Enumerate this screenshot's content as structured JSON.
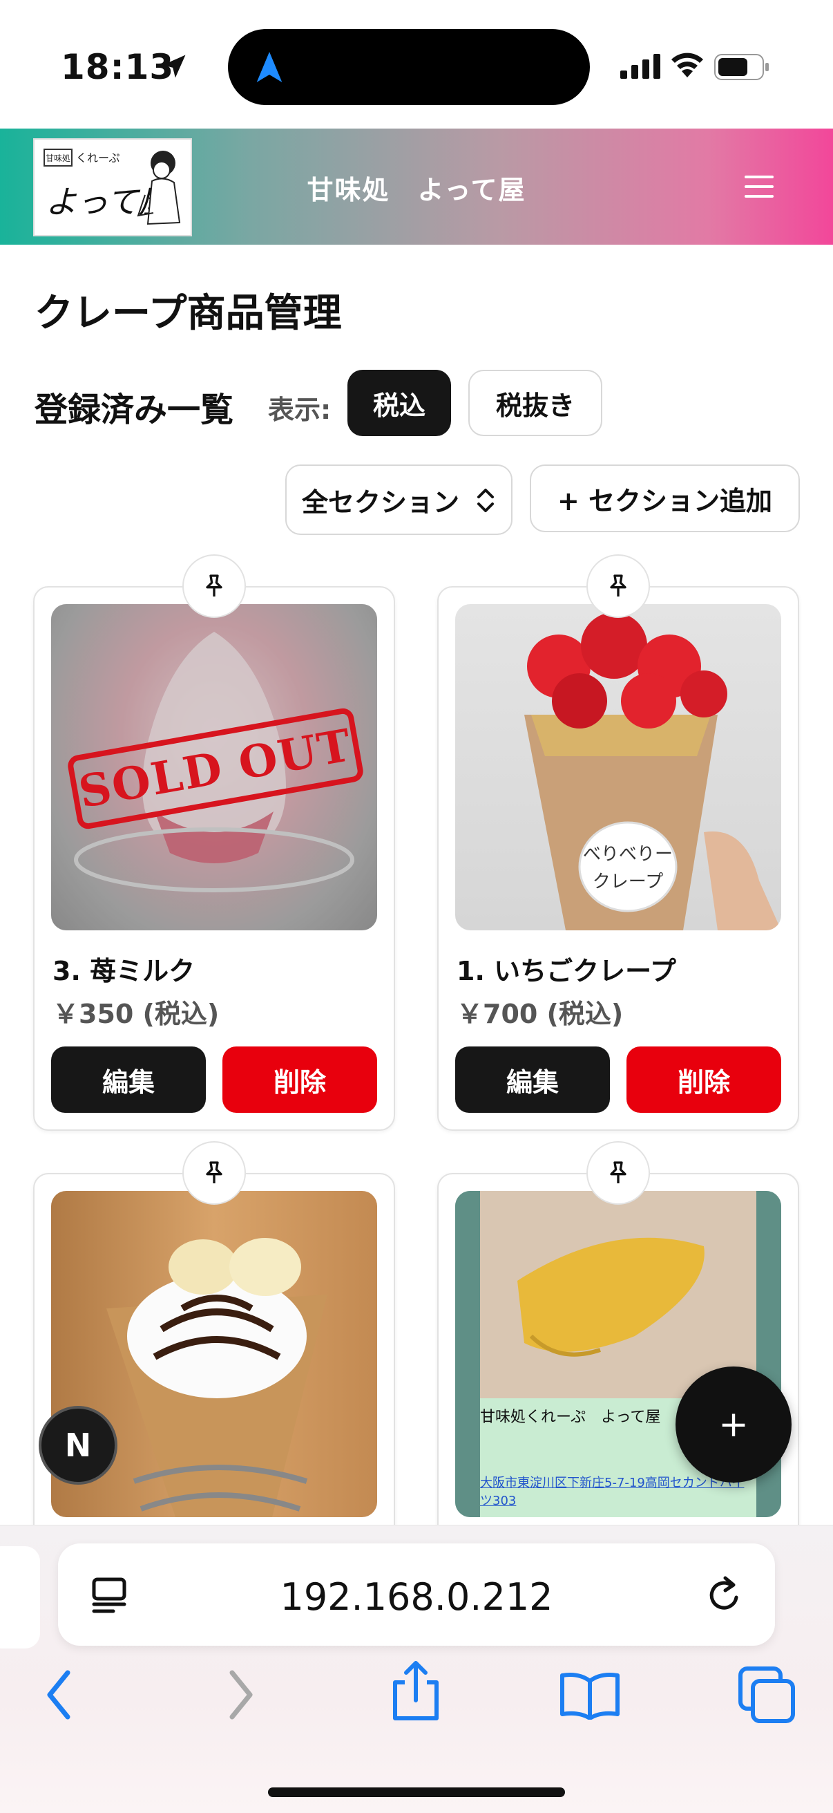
{
  "status_bar": {
    "time": "18:13"
  },
  "header": {
    "title": "甘味処　よって屋",
    "logo_alt": "甘味処 くれーぷ よって屋"
  },
  "page": {
    "title": "クレープ商品管理"
  },
  "list": {
    "title": "登録済み一覧",
    "tax_label": "表示:",
    "tax_in": "税込",
    "tax_ex": "税抜き",
    "section_select": "全セクション",
    "add_section": "+ セクション追加"
  },
  "products": [
    {
      "name": "3. 苺ミルク",
      "price": "￥350 (税込)",
      "edit": "編集",
      "delete": "削除",
      "sold_out_text": "SOLD OUT"
    },
    {
      "name": "1. いちごクレープ",
      "price": "￥700 (税込)",
      "edit": "編集",
      "delete": "削除"
    },
    {
      "name": "",
      "price": ""
    },
    {
      "name": "",
      "price": "",
      "shop_text": "甘味処くれーぷ　よって屋　店",
      "shop_address": "大阪市東淀川区下新庄5-7-19高岡セカンドハイツ303"
    }
  ],
  "fab": {
    "label": "+"
  },
  "badge": {
    "label": "N"
  },
  "browser": {
    "url": "192.168.0.212"
  }
}
